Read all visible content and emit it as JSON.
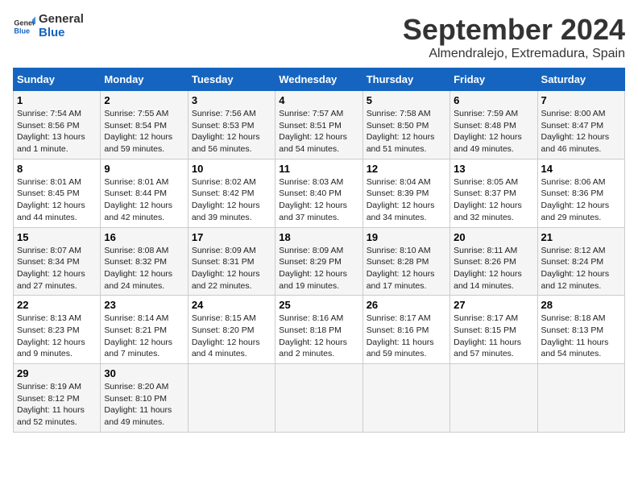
{
  "logo": {
    "line1": "General",
    "line2": "Blue"
  },
  "title": "September 2024",
  "subtitle": "Almendralejo, Extremadura, Spain",
  "days_of_week": [
    "Sunday",
    "Monday",
    "Tuesday",
    "Wednesday",
    "Thursday",
    "Friday",
    "Saturday"
  ],
  "weeks": [
    [
      {
        "day": 1,
        "info": "Sunrise: 7:54 AM\nSunset: 8:56 PM\nDaylight: 13 hours\nand 1 minute."
      },
      {
        "day": 2,
        "info": "Sunrise: 7:55 AM\nSunset: 8:54 PM\nDaylight: 12 hours\nand 59 minutes."
      },
      {
        "day": 3,
        "info": "Sunrise: 7:56 AM\nSunset: 8:53 PM\nDaylight: 12 hours\nand 56 minutes."
      },
      {
        "day": 4,
        "info": "Sunrise: 7:57 AM\nSunset: 8:51 PM\nDaylight: 12 hours\nand 54 minutes."
      },
      {
        "day": 5,
        "info": "Sunrise: 7:58 AM\nSunset: 8:50 PM\nDaylight: 12 hours\nand 51 minutes."
      },
      {
        "day": 6,
        "info": "Sunrise: 7:59 AM\nSunset: 8:48 PM\nDaylight: 12 hours\nand 49 minutes."
      },
      {
        "day": 7,
        "info": "Sunrise: 8:00 AM\nSunset: 8:47 PM\nDaylight: 12 hours\nand 46 minutes."
      }
    ],
    [
      {
        "day": 8,
        "info": "Sunrise: 8:01 AM\nSunset: 8:45 PM\nDaylight: 12 hours\nand 44 minutes."
      },
      {
        "day": 9,
        "info": "Sunrise: 8:01 AM\nSunset: 8:44 PM\nDaylight: 12 hours\nand 42 minutes."
      },
      {
        "day": 10,
        "info": "Sunrise: 8:02 AM\nSunset: 8:42 PM\nDaylight: 12 hours\nand 39 minutes."
      },
      {
        "day": 11,
        "info": "Sunrise: 8:03 AM\nSunset: 8:40 PM\nDaylight: 12 hours\nand 37 minutes."
      },
      {
        "day": 12,
        "info": "Sunrise: 8:04 AM\nSunset: 8:39 PM\nDaylight: 12 hours\nand 34 minutes."
      },
      {
        "day": 13,
        "info": "Sunrise: 8:05 AM\nSunset: 8:37 PM\nDaylight: 12 hours\nand 32 minutes."
      },
      {
        "day": 14,
        "info": "Sunrise: 8:06 AM\nSunset: 8:36 PM\nDaylight: 12 hours\nand 29 minutes."
      }
    ],
    [
      {
        "day": 15,
        "info": "Sunrise: 8:07 AM\nSunset: 8:34 PM\nDaylight: 12 hours\nand 27 minutes."
      },
      {
        "day": 16,
        "info": "Sunrise: 8:08 AM\nSunset: 8:32 PM\nDaylight: 12 hours\nand 24 minutes."
      },
      {
        "day": 17,
        "info": "Sunrise: 8:09 AM\nSunset: 8:31 PM\nDaylight: 12 hours\nand 22 minutes."
      },
      {
        "day": 18,
        "info": "Sunrise: 8:09 AM\nSunset: 8:29 PM\nDaylight: 12 hours\nand 19 minutes."
      },
      {
        "day": 19,
        "info": "Sunrise: 8:10 AM\nSunset: 8:28 PM\nDaylight: 12 hours\nand 17 minutes."
      },
      {
        "day": 20,
        "info": "Sunrise: 8:11 AM\nSunset: 8:26 PM\nDaylight: 12 hours\nand 14 minutes."
      },
      {
        "day": 21,
        "info": "Sunrise: 8:12 AM\nSunset: 8:24 PM\nDaylight: 12 hours\nand 12 minutes."
      }
    ],
    [
      {
        "day": 22,
        "info": "Sunrise: 8:13 AM\nSunset: 8:23 PM\nDaylight: 12 hours\nand 9 minutes."
      },
      {
        "day": 23,
        "info": "Sunrise: 8:14 AM\nSunset: 8:21 PM\nDaylight: 12 hours\nand 7 minutes."
      },
      {
        "day": 24,
        "info": "Sunrise: 8:15 AM\nSunset: 8:20 PM\nDaylight: 12 hours\nand 4 minutes."
      },
      {
        "day": 25,
        "info": "Sunrise: 8:16 AM\nSunset: 8:18 PM\nDaylight: 12 hours\nand 2 minutes."
      },
      {
        "day": 26,
        "info": "Sunrise: 8:17 AM\nSunset: 8:16 PM\nDaylight: 11 hours\nand 59 minutes."
      },
      {
        "day": 27,
        "info": "Sunrise: 8:17 AM\nSunset: 8:15 PM\nDaylight: 11 hours\nand 57 minutes."
      },
      {
        "day": 28,
        "info": "Sunrise: 8:18 AM\nSunset: 8:13 PM\nDaylight: 11 hours\nand 54 minutes."
      }
    ],
    [
      {
        "day": 29,
        "info": "Sunrise: 8:19 AM\nSunset: 8:12 PM\nDaylight: 11 hours\nand 52 minutes."
      },
      {
        "day": 30,
        "info": "Sunrise: 8:20 AM\nSunset: 8:10 PM\nDaylight: 11 hours\nand 49 minutes."
      },
      null,
      null,
      null,
      null,
      null
    ]
  ]
}
